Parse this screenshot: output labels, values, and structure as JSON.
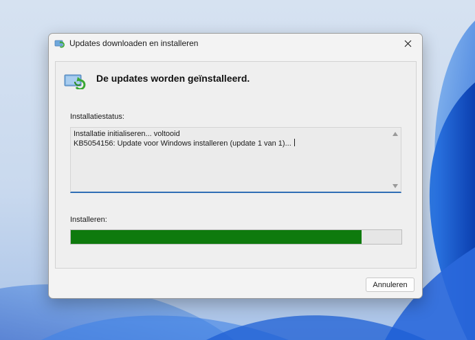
{
  "window": {
    "title": "Updates downloaden en installeren",
    "title_icon": "windows-update-icon",
    "close_icon": "close-icon"
  },
  "header": {
    "icon": "windows-update-icon",
    "title": "De updates worden geïnstalleerd."
  },
  "status": {
    "label": "Installatiestatus:",
    "lines": [
      "Installatie initialiseren... voltooid",
      "KB5054156: Update voor Windows installeren (update 1 van 1)..."
    ]
  },
  "progress": {
    "label": "Installeren:",
    "fraction": 0.88
  },
  "buttons": {
    "cancel": "Annuleren"
  },
  "colors": {
    "progress_fill": "#0e7a0d",
    "focus_underline": "#2e6db4",
    "update_arrows": "#3aa835"
  }
}
